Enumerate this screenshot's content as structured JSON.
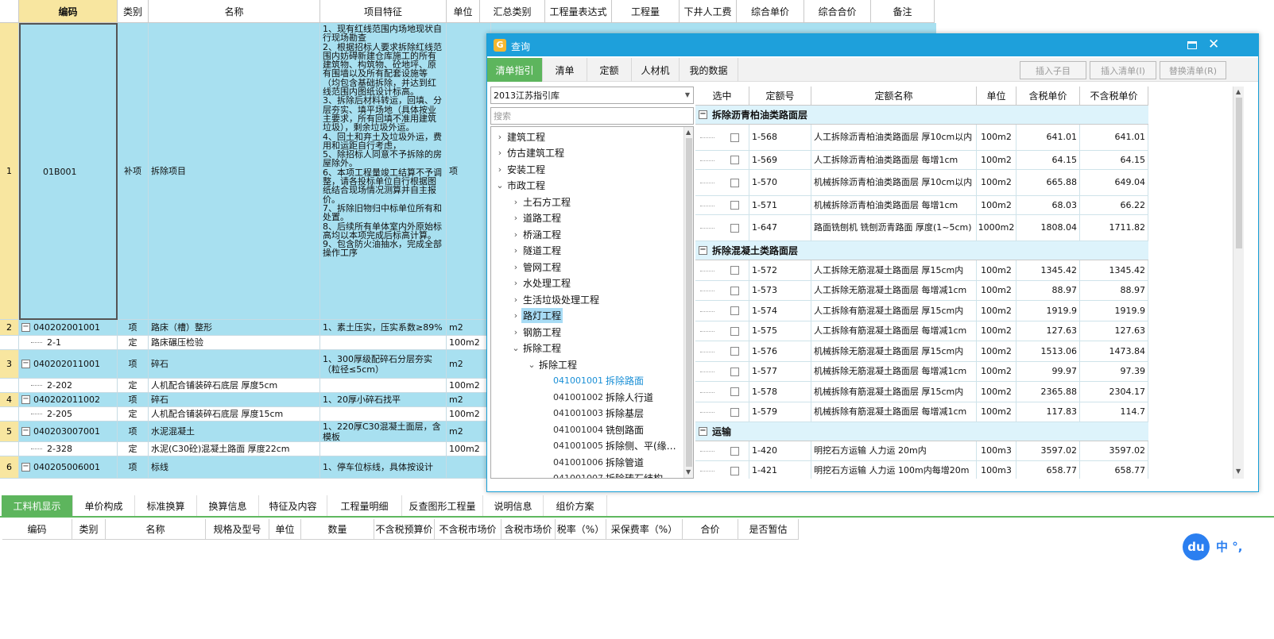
{
  "main": {
    "columns": [
      "编码",
      "类别",
      "名称",
      "项目特征",
      "单位",
      "汇总类别",
      "工程量表达式",
      "工程量",
      "下井人工费",
      "综合单价",
      "综合合价",
      "备注"
    ],
    "rows": [
      {
        "no": "1",
        "code": "01B001",
        "type": "补项",
        "name": "拆除项目",
        "unit": "项",
        "style": "blue",
        "feature": "1、现有红线范围内场地现状自行现场勘查\n2、根据招标人要求拆除红线范围内妨碍新建仓库施工的所有建筑物、构筑物、砼地坪、原有围墙以及所有配套设施等（均包含基础拆除，并达到红线范围内图纸设计标高。\n3、拆除后材料转运，回填、分层夯实、填平场地（具体按业主要求，所有回填不准用建筑垃圾），剩余垃圾外运。\n4、回土和弃土及垃圾外运，费用和运距自行考虑，\n5、除招标人同意不予拆除的房屋除外。\n6、本项工程量竣工结算不予调整，请各投标单位自行根据图纸结合现场情况测算并自主报价。\n7、拆除旧物归中标单位所有和处置。\n8、后续所有单体室内外原始标高均以本项完成后标高计算。\n9、包含防火油抽水，完成全部操作工序"
      },
      {
        "no": "2",
        "code": "040202001001",
        "type": "项",
        "name": "路床（槽）整形",
        "unit": "m2",
        "style": "blue",
        "feature": "1、素土压实，压实系数≥89%",
        "expander": "−"
      },
      {
        "no": "",
        "code": "2-1",
        "type": "定",
        "name": "路床碾压检验",
        "unit": "100m2",
        "style": "white",
        "feature": "",
        "child": true
      },
      {
        "no": "3",
        "code": "040202011001",
        "type": "项",
        "name": "碎石",
        "unit": "m2",
        "style": "blue",
        "feature": "1、300厚级配碎石分层夯实（粒径≤5cm）",
        "expander": "−"
      },
      {
        "no": "",
        "code": "2-202",
        "type": "定",
        "name": "人机配合铺装碎石底层 厚度5cm",
        "unit": "100m2",
        "style": "white",
        "feature": "",
        "child": true
      },
      {
        "no": "4",
        "code": "040202011002",
        "type": "项",
        "name": "碎石",
        "unit": "m2",
        "style": "blue",
        "feature": "1、20厚小碎石找平",
        "expander": "−"
      },
      {
        "no": "",
        "code": "2-205",
        "type": "定",
        "name": "人机配合铺装碎石底层 厚度15cm",
        "unit": "100m2",
        "style": "white",
        "feature": "",
        "child": true
      },
      {
        "no": "5",
        "code": "040203007001",
        "type": "项",
        "name": "水泥混凝土",
        "unit": "m2",
        "style": "blue",
        "feature": "1、220厚C30混凝土面层，含模板",
        "expander": "−"
      },
      {
        "no": "",
        "code": "2-328",
        "type": "定",
        "name": "水泥(C30砼)混凝土路面 厚度22cm",
        "unit": "100m2",
        "style": "white",
        "feature": "",
        "child": true
      },
      {
        "no": "6",
        "code": "040205006001",
        "type": "项",
        "name": "标线",
        "unit": "",
        "style": "blue",
        "feature": "1、停车位标线，具体按设计",
        "expander": "−"
      }
    ]
  },
  "bottom": {
    "tabs": [
      "工料机显示",
      "单价构成",
      "标准换算",
      "换算信息",
      "特征及内容",
      "工程量明细",
      "反查图形工程量",
      "说明信息",
      "组价方案"
    ],
    "columns": [
      "编码",
      "类别",
      "名称",
      "规格及型号",
      "单位",
      "数量",
      "不含税预算价",
      "不含税市场价",
      "含税市场价",
      "税率（%）",
      "采保费率（%）",
      "合价",
      "是否暂估"
    ]
  },
  "dialog": {
    "title": "查询",
    "tabs": [
      "清单指引",
      "清单",
      "定额",
      "人材机",
      "我的数据"
    ],
    "buttons": [
      "插入子目",
      "插入清单(I)",
      "替换清单(R)"
    ],
    "library": "2013江苏指引库",
    "search_placeholder": "搜索",
    "tree": [
      {
        "label": "建筑工程",
        "level": 0,
        "caret": "›"
      },
      {
        "label": "仿古建筑工程",
        "level": 0,
        "caret": "›"
      },
      {
        "label": "安装工程",
        "level": 0,
        "caret": "›"
      },
      {
        "label": "市政工程",
        "level": 0,
        "caret": "⌄"
      },
      {
        "label": "土石方工程",
        "level": 1,
        "caret": "›"
      },
      {
        "label": "道路工程",
        "level": 1,
        "caret": "›"
      },
      {
        "label": "桥涵工程",
        "level": 1,
        "caret": "›"
      },
      {
        "label": "隧道工程",
        "level": 1,
        "caret": "›"
      },
      {
        "label": "管网工程",
        "level": 1,
        "caret": "›"
      },
      {
        "label": "水处理工程",
        "level": 1,
        "caret": "›"
      },
      {
        "label": "生活垃圾处理工程",
        "level": 1,
        "caret": "›"
      },
      {
        "label": "路灯工程",
        "level": 1,
        "caret": "›",
        "selected": true
      },
      {
        "label": "钢筋工程",
        "level": 1,
        "caret": "›"
      },
      {
        "label": "拆除工程",
        "level": 1,
        "caret": "⌄"
      },
      {
        "label": "拆除工程",
        "level": 2,
        "caret": "⌄"
      },
      {
        "code": "041001001",
        "label": "拆除路面",
        "level": 3,
        "leaf": true,
        "selected": true
      },
      {
        "code": "041001002",
        "label": "拆除人行道",
        "level": 3,
        "leaf": true
      },
      {
        "code": "041001003",
        "label": "拆除基层",
        "level": 3,
        "leaf": true
      },
      {
        "code": "041001004",
        "label": "铣刨路面",
        "level": 3,
        "leaf": true
      },
      {
        "code": "041001005",
        "label": "拆除侧、平(缘…",
        "level": 3,
        "leaf": true
      },
      {
        "code": "041001006",
        "label": "拆除管道",
        "level": 3,
        "leaf": true
      },
      {
        "code": "041001007",
        "label": "拆除砖石结构",
        "level": 3,
        "leaf": true
      }
    ],
    "table_columns": [
      "选中",
      "定额号",
      "定额名称",
      "单位",
      "含税单价",
      "不含税单价"
    ],
    "groups": [
      {
        "title": "拆除沥青柏油类路面层",
        "rows": [
          {
            "code": "1-568",
            "name": "人工拆除沥青柏油类路面层 厚10cm以内",
            "unit": "100m2",
            "tax": "641.01",
            "notax": "641.01",
            "h": 33
          },
          {
            "code": "1-569",
            "name": "人工拆除沥青柏油类路面层 每增1cm",
            "unit": "100m2",
            "tax": "64.15",
            "notax": "64.15",
            "h": 24
          },
          {
            "code": "1-570",
            "name": "机械拆除沥青柏油类路面层 厚10cm以内",
            "unit": "100m2",
            "tax": "665.88",
            "notax": "649.04",
            "h": 33
          },
          {
            "code": "1-571",
            "name": "机械拆除沥青柏油类路面层 每增1cm",
            "unit": "100m2",
            "tax": "68.03",
            "notax": "66.22",
            "h": 24
          },
          {
            "code": "1-647",
            "name": "路面铣刨机 铣刨沥青路面 厚度(1~5cm)",
            "unit": "1000m2",
            "tax": "1808.04",
            "notax": "1711.82",
            "h": 33
          }
        ]
      },
      {
        "title": "拆除混凝土类路面层",
        "rows": [
          {
            "code": "1-572",
            "name": "人工拆除无筋混凝土路面层 厚15cm内",
            "unit": "100m2",
            "tax": "1345.42",
            "notax": "1345.42",
            "h": 26
          },
          {
            "code": "1-573",
            "name": "人工拆除无筋混凝土路面层 每增减1cm",
            "unit": "100m2",
            "tax": "88.97",
            "notax": "88.97",
            "h": 25
          },
          {
            "code": "1-574",
            "name": "人工拆除有筋混凝土路面层 厚15cm内",
            "unit": "100m2",
            "tax": "1919.9",
            "notax": "1919.9",
            "h": 26
          },
          {
            "code": "1-575",
            "name": "人工拆除有筋混凝土路面层 每增减1cm",
            "unit": "100m2",
            "tax": "127.63",
            "notax": "127.63",
            "h": 25
          },
          {
            "code": "1-576",
            "name": "机械拆除无筋混凝土路面层 厚15cm内",
            "unit": "100m2",
            "tax": "1513.06",
            "notax": "1473.84",
            "h": 26
          },
          {
            "code": "1-577",
            "name": "机械拆除无筋混凝土路面层 每增减1cm",
            "unit": "100m2",
            "tax": "99.97",
            "notax": "97.39",
            "h": 25
          },
          {
            "code": "1-578",
            "name": "机械拆除有筋混凝土路面层 厚15cm内",
            "unit": "100m2",
            "tax": "2365.88",
            "notax": "2304.17",
            "h": 26
          },
          {
            "code": "1-579",
            "name": "机械拆除有筋混凝土路面层 每增减1cm",
            "unit": "100m2",
            "tax": "117.83",
            "notax": "114.7",
            "h": 25
          }
        ]
      },
      {
        "title": "运输",
        "rows": [
          {
            "code": "1-420",
            "name": "明挖石方运输 人力运 20m内",
            "unit": "100m3",
            "tax": "3597.02",
            "notax": "3597.02",
            "h": 25
          },
          {
            "code": "1-421",
            "name": "明挖石方运输 人力运 100m内每增20m",
            "unit": "100m3",
            "tax": "658.77",
            "notax": "658.77",
            "h": 25
          }
        ]
      }
    ]
  },
  "ime": {
    "logo": "du",
    "text": "中 °,"
  },
  "colors": {
    "accent": "#1ea0db",
    "tab_green": "#5db55d",
    "row_blue": "#a8e0f0",
    "header_yellow": "#f8e6a0"
  }
}
